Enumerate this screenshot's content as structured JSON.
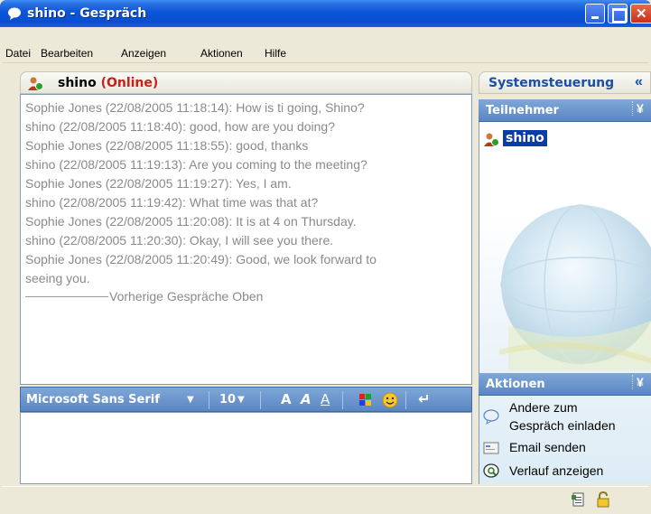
{
  "window": {
    "title": "shino - Gespräch"
  },
  "menu": {
    "items": [
      "Datei",
      "Bearbeiten",
      "Anzeigen",
      "Aktionen",
      "Hilfe"
    ]
  },
  "conversation": {
    "contact_name": "shino",
    "contact_status": "(Online)"
  },
  "transcript": {
    "lines": [
      "Sophie Jones  (22/08/2005 11:18:14): How is ti going, Shino?",
      "shino  (22/08/2005 11:18:40): good, how are you doing?",
      "Sophie Jones  (22/08/2005 11:18:55): good, thanks",
      "shino  (22/08/2005 11:19:13): Are you coming to the meeting?",
      "Sophie Jones  (22/08/2005 11:19:27): Yes, I am.",
      "shino  (22/08/2005 11:19:42): What time was that at?",
      "Sophie Jones  (22/08/2005 11:20:08): It is at 4 on Thursday.",
      "shino  (22/08/2005 11:20:30): Okay, I will see you there.",
      "Sophie Jones  (22/08/2005 11:20:49): Good, we look forward to",
      "seeing you."
    ],
    "separator_text": "Vorherige Gespräche Oben"
  },
  "format_bar": {
    "font_name": "Microsoft Sans Serif",
    "font_size": "10",
    "bold_label": "A",
    "italic_label": "A",
    "underline_label": "A"
  },
  "input": {
    "value": ""
  },
  "side_panel": {
    "title": "Systemsteuerung",
    "collapse_glyph": "«",
    "participants_title": "Teilnehmer",
    "participants": [
      "shino"
    ],
    "actions_title": "Aktionen",
    "actions": {
      "invite_line1": "Andere zum",
      "invite_line2": "Gespräch einladen",
      "email": "Email senden",
      "history": "Verlauf anzeigen"
    }
  },
  "colors": {
    "status_online": "#c8201a",
    "panel_accent": "#1a4fa8",
    "selection": "#0a3ca8"
  }
}
